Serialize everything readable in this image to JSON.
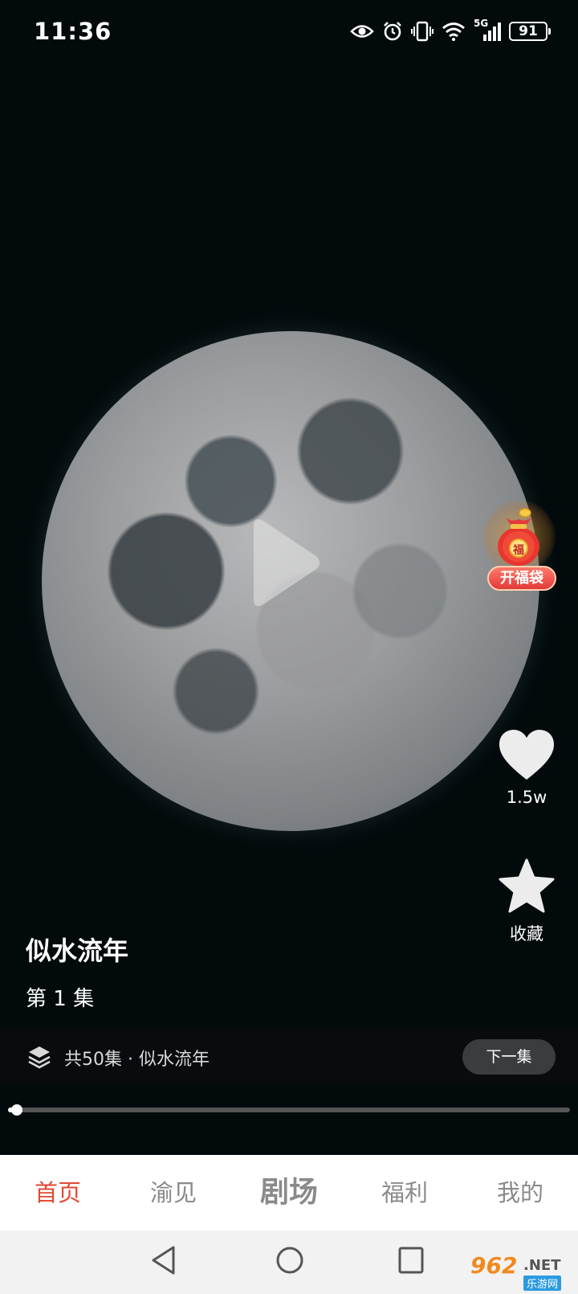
{
  "status_bar": {
    "time": "11:36",
    "network": "5G",
    "battery": "91"
  },
  "video": {
    "play_state": "paused"
  },
  "lucky_bag": {
    "label": "开福袋",
    "badge": "福"
  },
  "actions": {
    "like_count": "1.5w",
    "favorite_label": "收藏"
  },
  "drama": {
    "title": "似水流年",
    "episode": "第 1 集",
    "series_info": "共50集 · 似水流年",
    "next_label": "下一集",
    "progress": 0.015
  },
  "tabs": [
    {
      "label": "首页",
      "active": true
    },
    {
      "label": "渝见",
      "active": false
    },
    {
      "label": "剧场",
      "active": false
    },
    {
      "label": "福利",
      "active": false
    },
    {
      "label": "我的",
      "active": false
    }
  ],
  "watermark": {
    "number": "962",
    "net": ".NET",
    "sub": "乐游网"
  },
  "colors": {
    "accent": "#e24a35",
    "background": "#020a0c",
    "tab_inactive": "#8a8a8a"
  }
}
